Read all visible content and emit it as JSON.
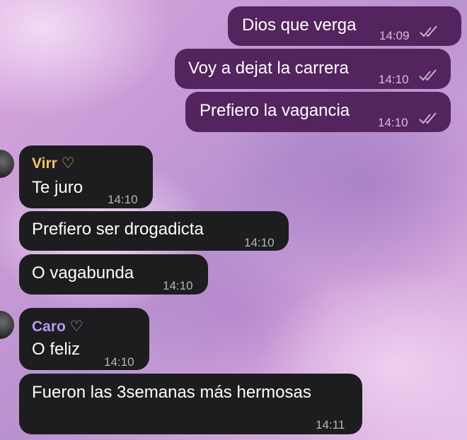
{
  "colors": {
    "outgoing_bubble": "#54245f",
    "incoming_bubble": "#1d1d1f",
    "sender_virr": "#f5c56a",
    "sender_caro": "#b79cf0",
    "read_ticks": "#c9b2d0"
  },
  "outgoing": [
    {
      "text": "Dios que verga",
      "time": "14:09",
      "status_icon": "double-check-read-icon"
    },
    {
      "text": "Voy a dejat la carrera",
      "time": "14:10",
      "status_icon": "double-check-read-icon"
    },
    {
      "text": "Prefiero la vagancia",
      "time": "14:10",
      "status_icon": "double-check-read-icon"
    }
  ],
  "incoming_group_1": {
    "sender": "Virr ♡",
    "messages": [
      {
        "text": "Te juro",
        "time": "14:10"
      },
      {
        "text": "Prefiero ser drogadicta",
        "time": "14:10"
      },
      {
        "text": "O vagabunda",
        "time": "14:10"
      }
    ]
  },
  "incoming_group_2": {
    "sender": "Caro ♡",
    "messages": [
      {
        "text": "O feliz",
        "time": "14:10"
      },
      {
        "text": "Fueron las 3semanas más hermosas",
        "time": "14:11"
      }
    ]
  }
}
